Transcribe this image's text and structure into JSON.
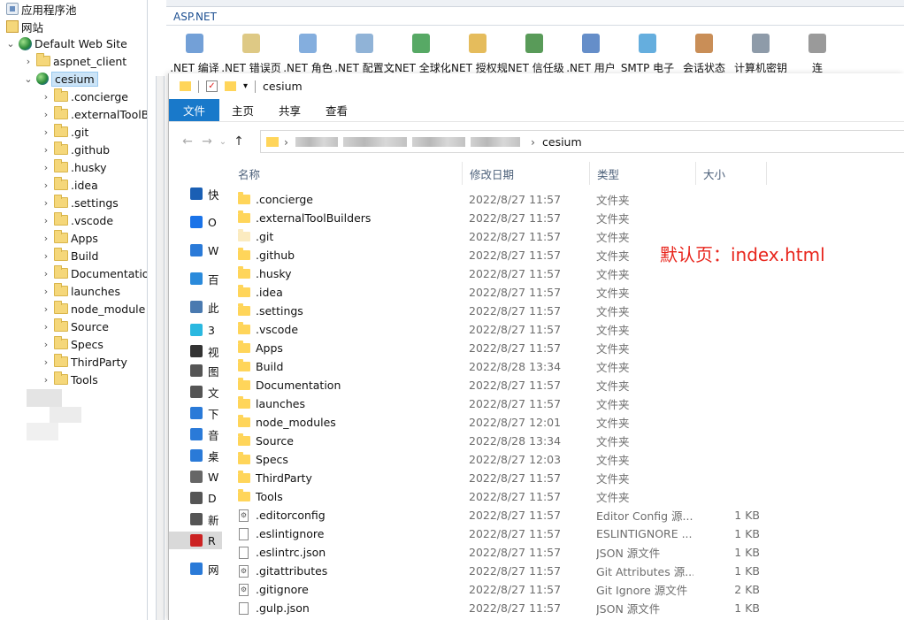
{
  "iis_tree": {
    "app_pools": "应用程序池",
    "sites": "网站",
    "default_site": "Default Web Site",
    "aspnet_client": "aspnet_client",
    "cesium": "cesium",
    "children": [
      ".concierge",
      ".externalToolB",
      ".git",
      ".github",
      ".husky",
      ".idea",
      ".settings",
      ".vscode",
      "Apps",
      "Build",
      "Documentatio",
      "launches",
      "node_module",
      "Source",
      "Specs",
      "ThirdParty",
      "Tools"
    ]
  },
  "iis_features": {
    "section": "ASP.NET",
    "items": [
      ".NET 编译",
      ".NET 错误页",
      ".NET 角色",
      ".NET 配置文",
      ".NET 全球化",
      ".NET 授权规",
      ".NET 信任级",
      ".NET 用户",
      "SMTP 电子",
      "会话状态",
      "计算机密钥",
      "连"
    ]
  },
  "explorer": {
    "title": "cesium",
    "ribbon_tabs": [
      "文件",
      "主页",
      "共享",
      "查看"
    ],
    "address_current": "cesium",
    "nav_items": [
      "快",
      "O",
      "W",
      "百",
      "此",
      "3",
      "视",
      "图",
      "文",
      "下",
      "音",
      "桌",
      "W",
      "D",
      "新",
      "R",
      "网"
    ],
    "columns": {
      "name": "名称",
      "date": "修改日期",
      "type": "类型",
      "size": "大小"
    },
    "files": [
      {
        "name": ".concierge",
        "date": "2022/8/27 11:57",
        "type": "文件夹",
        "size": "",
        "kind": "folder"
      },
      {
        "name": ".externalToolBuilders",
        "date": "2022/8/27 11:57",
        "type": "文件夹",
        "size": "",
        "kind": "folder"
      },
      {
        "name": ".git",
        "date": "2022/8/27 11:57",
        "type": "文件夹",
        "size": "",
        "kind": "folder-ghost"
      },
      {
        "name": ".github",
        "date": "2022/8/27 11:57",
        "type": "文件夹",
        "size": "",
        "kind": "folder"
      },
      {
        "name": ".husky",
        "date": "2022/8/27 11:57",
        "type": "文件夹",
        "size": "",
        "kind": "folder"
      },
      {
        "name": ".idea",
        "date": "2022/8/27 11:57",
        "type": "文件夹",
        "size": "",
        "kind": "folder"
      },
      {
        "name": ".settings",
        "date": "2022/8/27 11:57",
        "type": "文件夹",
        "size": "",
        "kind": "folder"
      },
      {
        "name": ".vscode",
        "date": "2022/8/27 11:57",
        "type": "文件夹",
        "size": "",
        "kind": "folder"
      },
      {
        "name": "Apps",
        "date": "2022/8/27 11:57",
        "type": "文件夹",
        "size": "",
        "kind": "folder"
      },
      {
        "name": "Build",
        "date": "2022/8/28 13:34",
        "type": "文件夹",
        "size": "",
        "kind": "folder"
      },
      {
        "name": "Documentation",
        "date": "2022/8/27 11:57",
        "type": "文件夹",
        "size": "",
        "kind": "folder"
      },
      {
        "name": "launches",
        "date": "2022/8/27 11:57",
        "type": "文件夹",
        "size": "",
        "kind": "folder"
      },
      {
        "name": "node_modules",
        "date": "2022/8/27 12:01",
        "type": "文件夹",
        "size": "",
        "kind": "folder"
      },
      {
        "name": "Source",
        "date": "2022/8/28 13:34",
        "type": "文件夹",
        "size": "",
        "kind": "folder"
      },
      {
        "name": "Specs",
        "date": "2022/8/27 12:03",
        "type": "文件夹",
        "size": "",
        "kind": "folder"
      },
      {
        "name": "ThirdParty",
        "date": "2022/8/27 11:57",
        "type": "文件夹",
        "size": "",
        "kind": "folder"
      },
      {
        "name": "Tools",
        "date": "2022/8/27 11:57",
        "type": "文件夹",
        "size": "",
        "kind": "folder"
      },
      {
        "name": ".editorconfig",
        "date": "2022/8/27 11:57",
        "type": "Editor Config 源...",
        "size": "1 KB",
        "kind": "config"
      },
      {
        "name": ".eslintignore",
        "date": "2022/8/27 11:57",
        "type": "ESLINTIGNORE ...",
        "size": "1 KB",
        "kind": "file"
      },
      {
        "name": ".eslintrc.json",
        "date": "2022/8/27 11:57",
        "type": "JSON 源文件",
        "size": "1 KB",
        "kind": "file"
      },
      {
        "name": ".gitattributes",
        "date": "2022/8/27 11:57",
        "type": "Git Attributes 源...",
        "size": "1 KB",
        "kind": "config"
      },
      {
        "name": ".gitignore",
        "date": "2022/8/27 11:57",
        "type": "Git Ignore 源文件",
        "size": "2 KB",
        "kind": "config"
      },
      {
        "name": ".gulp.json",
        "date": "2022/8/27 11:57",
        "type": "JSON 源文件",
        "size": "1 KB",
        "kind": "file"
      }
    ]
  },
  "annotation": "默认页：index.html",
  "colors": {
    "ribbon_active": "#1979ca",
    "annotation": "#e8251c",
    "folder": "#ffd55a",
    "selection": "#cce4f7"
  }
}
